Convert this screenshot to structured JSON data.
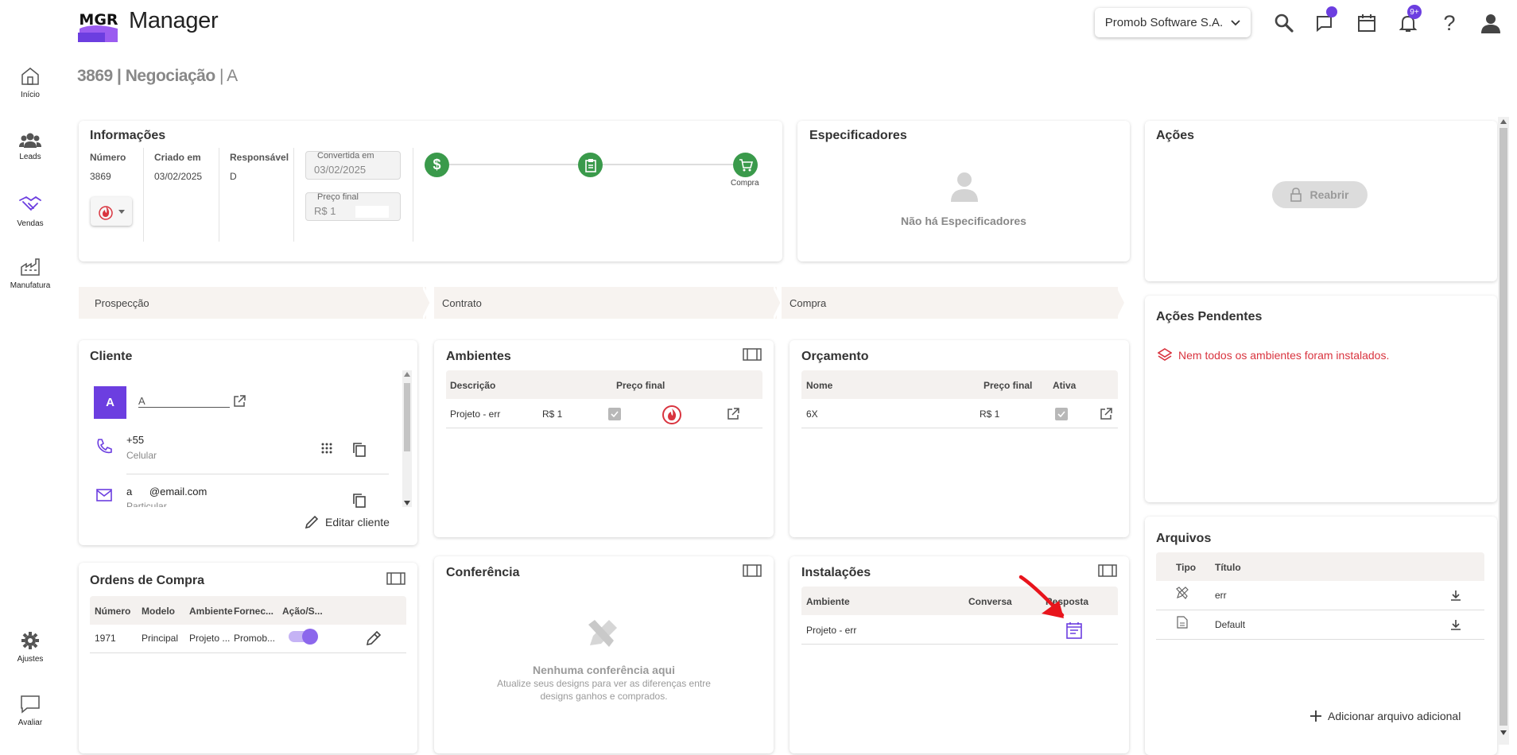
{
  "app": {
    "logo_text": "MGR",
    "name": "Manager"
  },
  "header": {
    "company": "Promob Software S.A.",
    "notifications_badge": "9+"
  },
  "sidebar": {
    "items": [
      {
        "label": "Início",
        "icon": "home-icon"
      },
      {
        "label": "Leads",
        "icon": "users-icon"
      },
      {
        "label": "Vendas",
        "icon": "handshake-icon"
      },
      {
        "label": "Manufatura",
        "icon": "factory-icon"
      },
      {
        "label": "Ajustes",
        "icon": "gear-icon"
      },
      {
        "label": "Avaliar",
        "icon": "chat-icon"
      }
    ]
  },
  "page": {
    "id": "3869",
    "title": "Negociação",
    "client": "A"
  },
  "info": {
    "title": "Informações",
    "numero_label": "Número",
    "numero": "3869",
    "criado_label": "Criado em",
    "criado": "03/02/2025",
    "responsavel_label": "Responsável",
    "responsavel": "D",
    "convertida_label": "Convertida em",
    "convertida": "03/02/2025",
    "preco_label": "Preço final",
    "preco": "R$ 1",
    "steps": [
      "",
      "",
      "Compra"
    ]
  },
  "especificadores": {
    "title": "Especificadores",
    "empty": "Não há Especificadores"
  },
  "acoes": {
    "title": "Ações",
    "reabrir": "Reabrir"
  },
  "pipeline": [
    "Prospecção",
    "Contrato",
    "Compra"
  ],
  "cliente": {
    "title": "Cliente",
    "avatar": "A",
    "name": "A",
    "phone": "+55",
    "phone_type": "Celular",
    "email": "a      @email.com",
    "email_type": "Particular",
    "edit": "Editar cliente"
  },
  "ambientes": {
    "title": "Ambientes",
    "headers": [
      "Descrição",
      "Preço final"
    ],
    "rows": [
      {
        "descricao": "Projeto - err",
        "preco": "R$ 1"
      }
    ]
  },
  "orcamento": {
    "title": "Orçamento",
    "headers": [
      "Nome",
      "Preço final",
      "Ativa"
    ],
    "rows": [
      {
        "nome": "6X",
        "preco": "R$ 1"
      }
    ]
  },
  "acoes_pendentes": {
    "title": "Ações Pendentes",
    "warning": "Nem todos os ambientes foram instalados."
  },
  "ordens": {
    "title": "Ordens de Compra",
    "headers": [
      "Número",
      "Modelo",
      "Ambiente",
      "Fornec...",
      "Ação/S..."
    ],
    "rows": [
      {
        "numero": "1971",
        "modelo": "Principal",
        "ambiente": "Projeto ...",
        "fornecedor": "Promob..."
      }
    ]
  },
  "conferencia": {
    "title": "Conferência",
    "empty_title": "Nenhuma conferência aqui",
    "empty_line1": "Atualize seus designs para ver as diferenças entre",
    "empty_line2": "designs ganhos e comprados."
  },
  "instalacoes": {
    "title": "Instalações",
    "headers": [
      "Ambiente",
      "Conversa",
      "Resposta"
    ],
    "rows": [
      {
        "ambiente": "Projeto - err"
      }
    ]
  },
  "arquivos": {
    "title": "Arquivos",
    "headers": [
      "Tipo",
      "Título"
    ],
    "rows": [
      {
        "titulo": "err"
      },
      {
        "titulo": "Default"
      }
    ],
    "add": "Adicionar arquivo adicional"
  },
  "colors": {
    "accent": "#6c3ee0",
    "green": "#3a9a4b",
    "warning": "#d9343f",
    "annotation": "#e8141c"
  }
}
